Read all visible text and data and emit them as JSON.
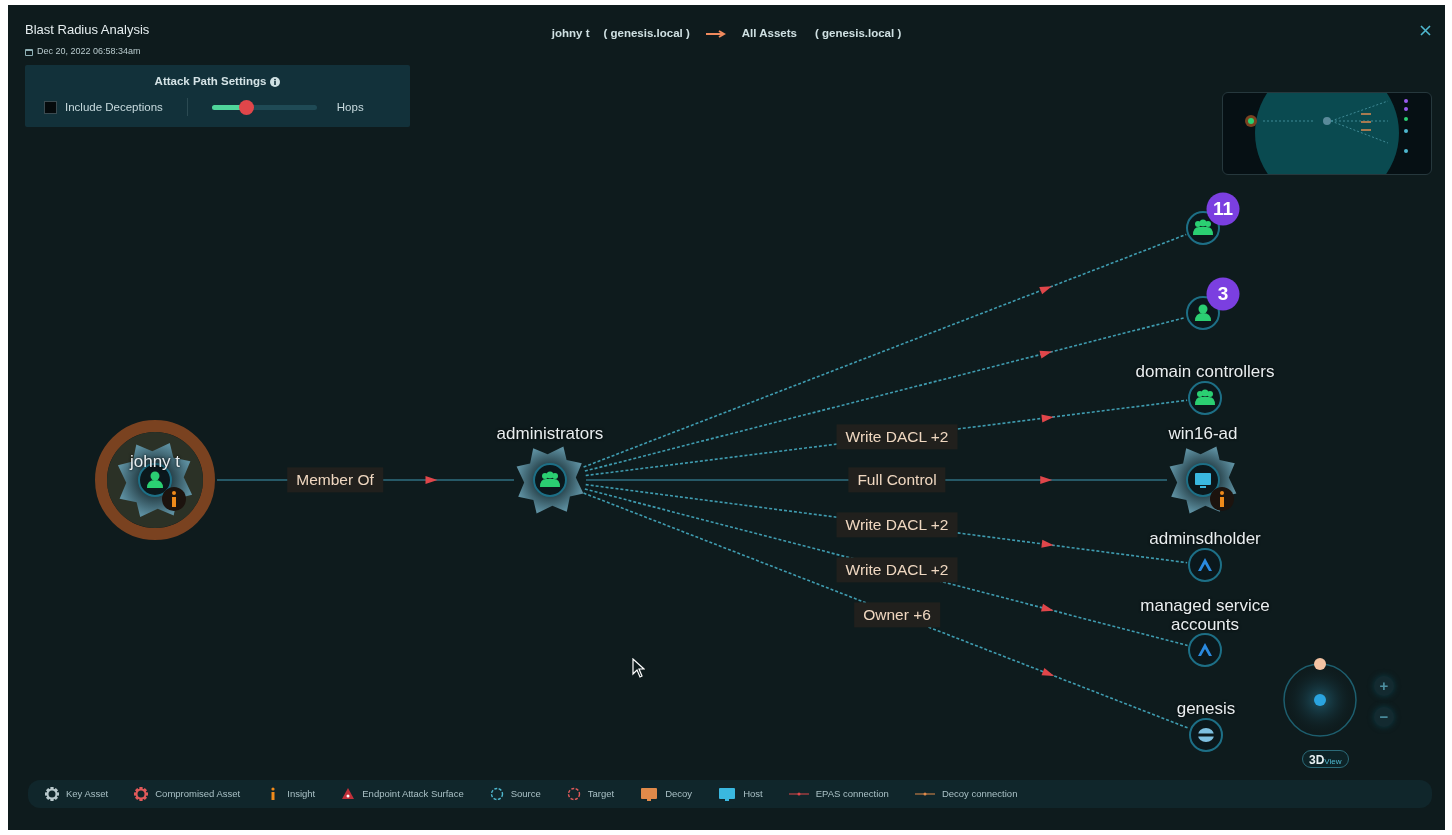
{
  "header": {
    "title": "Blast Radius Analysis",
    "date": "Dec 20, 2022 06:58:34am",
    "source": "johny t",
    "source_domain": "( genesis.local )",
    "target": "All Assets",
    "target_domain": "( genesis.local )"
  },
  "settings": {
    "title": "Attack Path Settings",
    "include_deceptions": {
      "label": "Include Deceptions",
      "checked": false
    },
    "hops_slider": {
      "label": "Hops",
      "level": 0.33
    }
  },
  "nodes": [
    {
      "label": "johny t",
      "kind": "user",
      "key_asset": true,
      "compromised": true,
      "insight": true
    },
    {
      "label": "administrators",
      "kind": "group",
      "key_asset": true,
      "compromised": false,
      "insight": false
    },
    {
      "kind": "group",
      "key_asset": false,
      "compromised": false,
      "insight": false,
      "badge": "11"
    },
    {
      "kind": "user",
      "key_asset": false,
      "compromised": false,
      "insight": false,
      "badge": "3"
    },
    {
      "label": "domain controllers",
      "kind": "group",
      "key_asset": false,
      "compromised": false,
      "insight": false
    },
    {
      "label": "win16-ad",
      "kind": "host",
      "key_asset": true,
      "compromised": false,
      "insight": true
    },
    {
      "label": "adminsdholder",
      "kind": "container",
      "key_asset": false,
      "compromised": false,
      "insight": false
    },
    {
      "label": "managed service accounts",
      "kind": "container",
      "key_asset": false,
      "compromised": false,
      "insight": false
    },
    {
      "label": "genesis",
      "kind": "domain",
      "key_asset": false,
      "compromised": false,
      "insight": false
    }
  ],
  "edges": [
    {
      "label": "Member Of",
      "dashed": false
    },
    {
      "dashed": true
    },
    {
      "dashed": true
    },
    {
      "label": "Write DACL +2",
      "dashed": true
    },
    {
      "label": "Full Control",
      "dashed": false
    },
    {
      "label": "Write DACL +2",
      "dashed": true
    },
    {
      "label": "Write DACL +2",
      "dashed": true
    },
    {
      "label": "Owner +6",
      "dashed": true
    }
  ],
  "view_controls": {
    "zoom_in": "+",
    "zoom_out": "−",
    "view_main": "3D",
    "view_sub": "View"
  },
  "legend": [
    {
      "kind": "key_asset",
      "label": "Key Asset"
    },
    {
      "kind": "compromised",
      "label": "Compromised Asset"
    },
    {
      "kind": "insight",
      "label": "Insight"
    },
    {
      "kind": "endpoint",
      "label": "Endpoint Attack Surface"
    },
    {
      "kind": "source",
      "label": "Source"
    },
    {
      "kind": "target",
      "label": "Target"
    },
    {
      "kind": "decoy",
      "label": "Decoy"
    },
    {
      "kind": "host",
      "label": "Host"
    },
    {
      "kind": "epas",
      "label": "EPAS connection"
    },
    {
      "kind": "decoy_conn",
      "label": "Decoy connection"
    }
  ]
}
